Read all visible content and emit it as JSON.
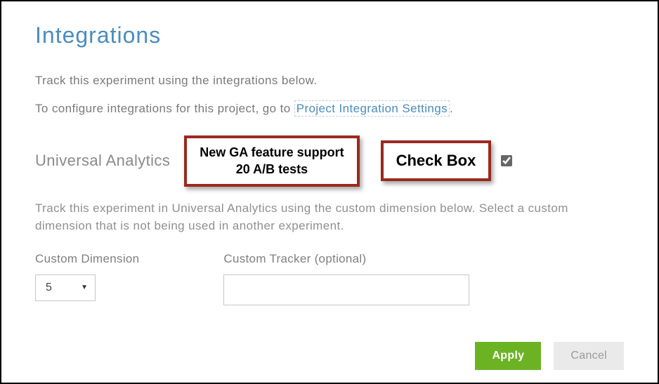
{
  "page": {
    "title": "Integrations",
    "description": "Track this experiment using the integrations below.",
    "config_prefix": "To configure integrations for this project, go to ",
    "config_link": "Project Integration Settings",
    "config_suffix": "."
  },
  "analytics": {
    "heading": "Universal Analytics",
    "helper": "Track this experiment in Universal Analytics using the custom dimension below. Select a custom dimension that is not being used in another experiment.",
    "checked": true
  },
  "callouts": {
    "ga_line1": "New GA feature support",
    "ga_line2": "20 A/B tests",
    "checkbox": "Check Box"
  },
  "form": {
    "custom_dimension_label": "Custom Dimension",
    "custom_dimension_value": "5",
    "custom_tracker_label": "Custom Tracker (optional)",
    "custom_tracker_value": ""
  },
  "buttons": {
    "apply": "Apply",
    "cancel": "Cancel"
  }
}
